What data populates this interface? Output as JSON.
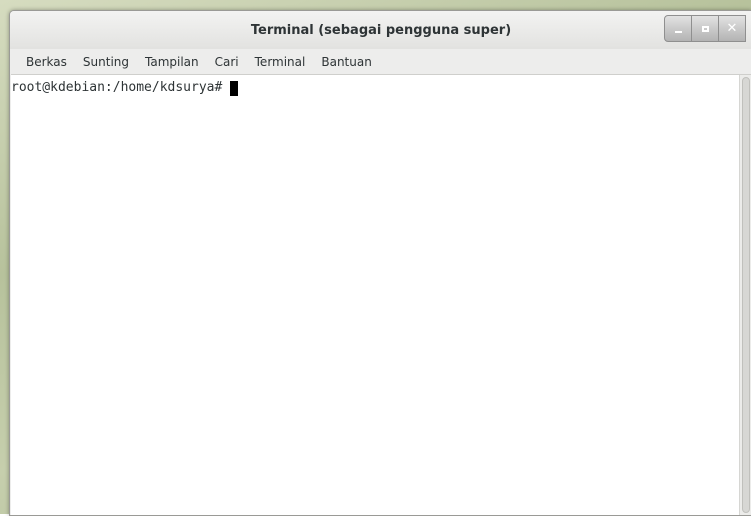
{
  "window": {
    "title": "Terminal (sebagai pengguna super)"
  },
  "menubar": {
    "items": [
      {
        "label": "Berkas"
      },
      {
        "label": "Sunting"
      },
      {
        "label": "Tampilan"
      },
      {
        "label": "Cari"
      },
      {
        "label": "Terminal"
      },
      {
        "label": "Bantuan"
      }
    ]
  },
  "terminal": {
    "prompt": "root@kdebian:/home/kdsurya#"
  },
  "icons": {
    "minimize": "minimize-icon",
    "maximize": "maximize-icon",
    "close": "close-icon"
  },
  "colors": {
    "window_bg": "#ededec",
    "terminal_bg": "#ffffff",
    "text": "#2e3436",
    "cursor": "#000000",
    "wm_button": "#b3b3b3"
  }
}
